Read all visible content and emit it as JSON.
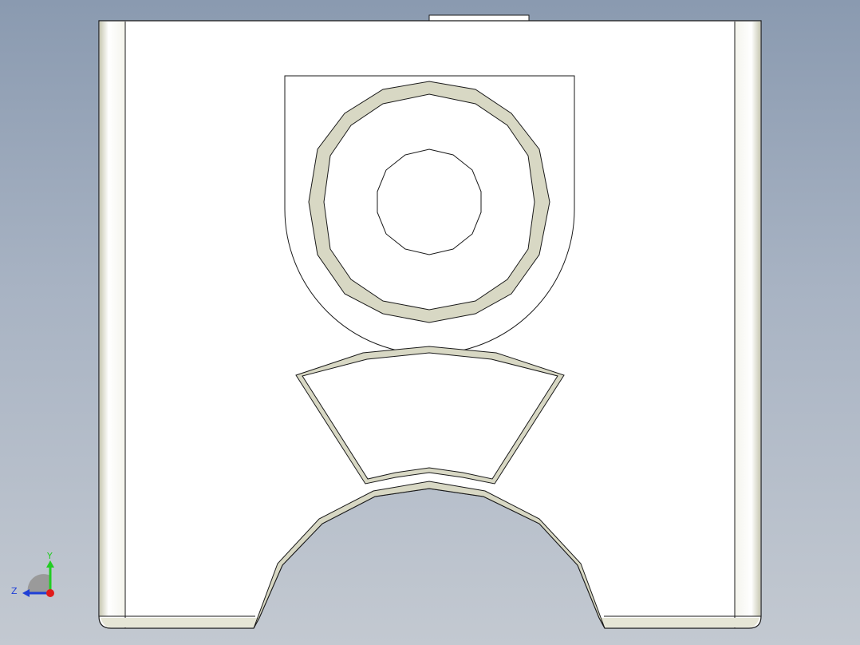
{
  "viewport": {
    "background_top": "#8a9ab0",
    "background_bottom": "#c3c9d1",
    "part_face_color": "#ffffff",
    "edge_color": "#1a1a1a",
    "fillet_shade_color": "#d8d8c4"
  },
  "triad": {
    "y_label": "Y",
    "z_label": "Z",
    "y_axis_color": "#22cc22",
    "z_axis_color": "#1f3fd6",
    "x_axis_color": "#e01b1b",
    "icon": "view-orientation-triad-icon"
  }
}
